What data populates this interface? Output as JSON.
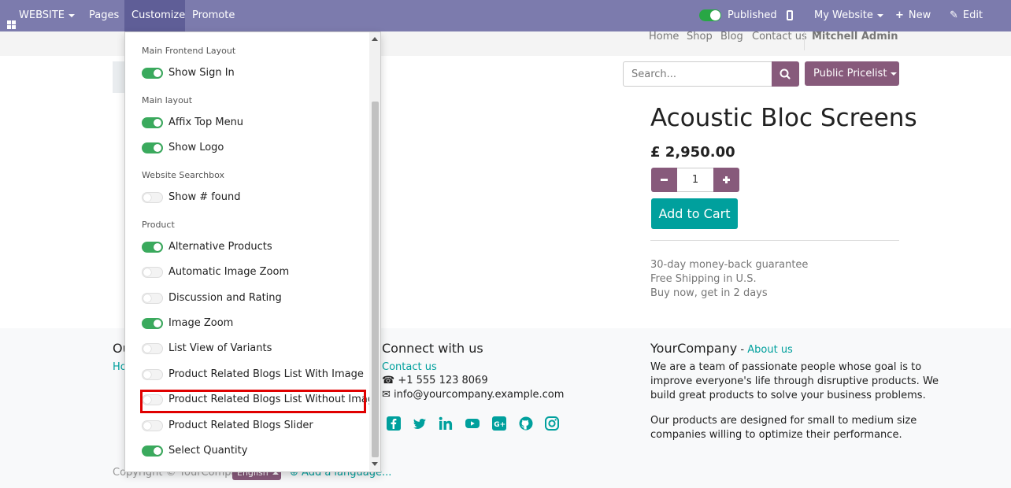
{
  "topbar": {
    "website_label": "WEBSITE",
    "menu": [
      "Pages",
      "Customize",
      "Promote"
    ],
    "published_label": "Published",
    "my_website_label": "My Website",
    "new_label": "New",
    "edit_label": "Edit"
  },
  "site_nav": {
    "links": [
      "Home",
      "Shop",
      "Blog",
      "Contact us"
    ],
    "user": "Mitchell Admin"
  },
  "search": {
    "placeholder": "Search..."
  },
  "pricelist_label": "Public Pricelist",
  "product": {
    "name": "Acoustic Bloc Screens",
    "price": "£ 2,950.00",
    "quantity": "1",
    "add_to_cart": "Add to Cart",
    "guarantees": [
      "30-day money-back guarantee",
      "Free Shipping in U.S.",
      "Buy now, get in 2 days"
    ]
  },
  "customize_menu": {
    "sections": [
      {
        "header": "Main Frontend Layout",
        "items": [
          {
            "label": "Show Sign In",
            "on": true
          }
        ]
      },
      {
        "header": "Main layout",
        "items": [
          {
            "label": "Affix Top Menu",
            "on": true
          },
          {
            "label": "Show Logo",
            "on": true
          }
        ]
      },
      {
        "header": "Website Searchbox",
        "items": [
          {
            "label": "Show # found",
            "on": false
          }
        ]
      },
      {
        "header": "Product",
        "items": [
          {
            "label": "Alternative Products",
            "on": true
          },
          {
            "label": "Automatic Image Zoom",
            "on": false
          },
          {
            "label": "Discussion and Rating",
            "on": false
          },
          {
            "label": "Image Zoom",
            "on": true
          },
          {
            "label": "List View of Variants",
            "on": false
          },
          {
            "label": "Product Related Blogs List With Image",
            "on": false
          },
          {
            "label": "Product Related Blogs List Without Image",
            "on": false
          },
          {
            "label": "Product Related Blogs Slider",
            "on": false
          },
          {
            "label": "Select Quantity",
            "on": true
          }
        ]
      }
    ]
  },
  "footer": {
    "col1_heading_partial": "Ou",
    "col1_link_partial": "Ho",
    "connect_heading": "Connect with us",
    "contact_link": "Contact us",
    "phone": "+1 555 123 8069",
    "email": "info@yourcompany.example.com",
    "company_name": "YourCompany",
    "company_sep": " - ",
    "about_link": "About us",
    "about_p1": [
      "We are a team of passionate people whose goal is to",
      "improve everyone's life through disruptive products. We",
      "build great products to solve your business problems."
    ],
    "about_p2": [
      "Our products are designed for small to medium size",
      "companies willing to optimize their performance."
    ],
    "copyright": "Copyright © YourCompany",
    "language": "English",
    "add_language": "Add a language..."
  },
  "colors": {
    "topbar": "#7c7bad",
    "accent": "#875a7b",
    "teal": "#00a09d",
    "toggle_on": "#3aaa5d",
    "highlight": "#e00000"
  }
}
